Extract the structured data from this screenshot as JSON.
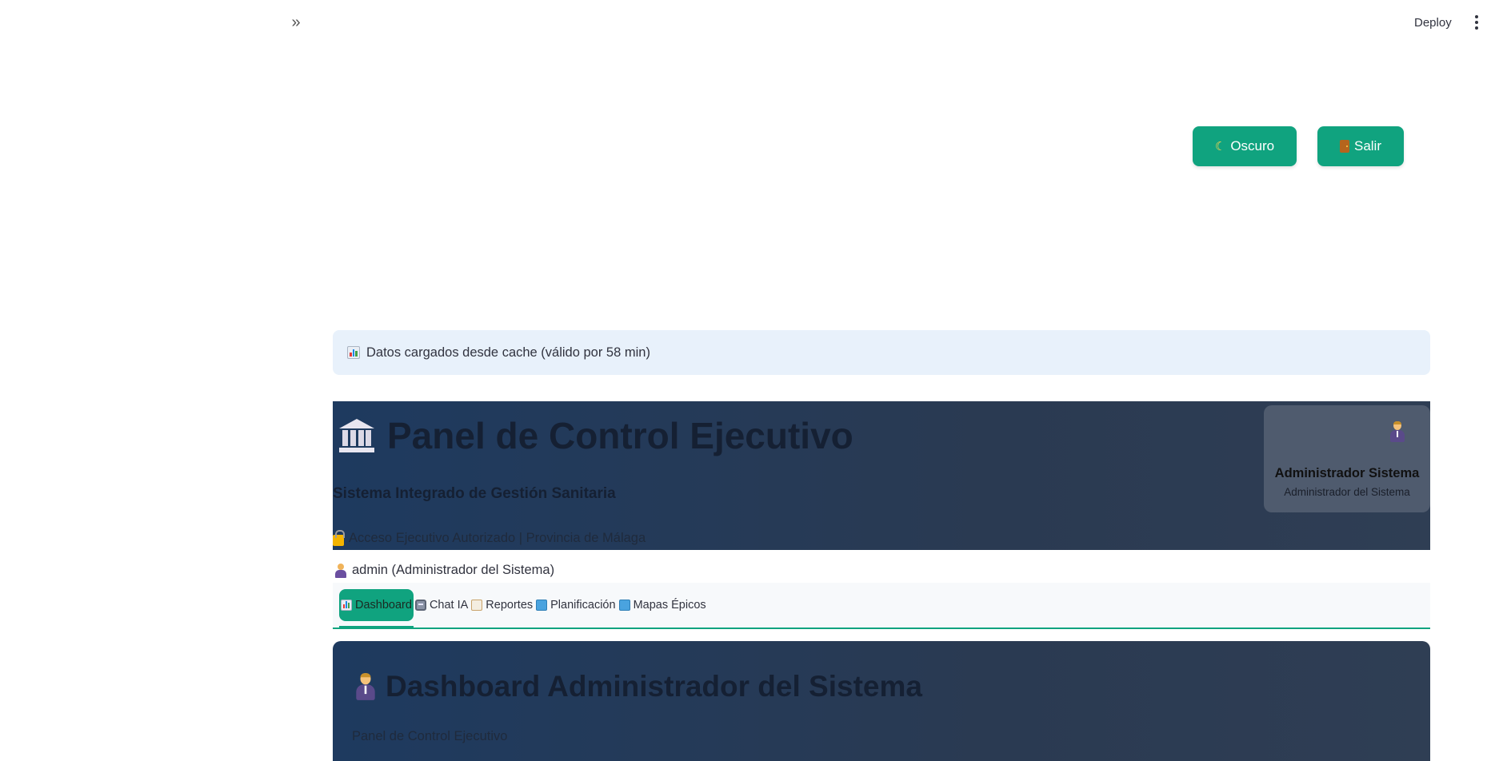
{
  "toolbar": {
    "expand_glyph": "»",
    "deploy_label": "Deploy"
  },
  "actions": {
    "dark_label": "Oscuro",
    "logout_label": "Salir"
  },
  "cache_notice": {
    "text": "Datos cargados desde cache (válido por 58 min)"
  },
  "header": {
    "title": "Panel de Control Ejecutivo",
    "subtitle": "Sistema Integrado de Gestión Sanitaria",
    "access": "Acceso Ejecutivo Autorizado | Provincia de Málaga",
    "user_card": {
      "name": "Administrador Sistema",
      "role": "Administrador del Sistema"
    }
  },
  "session": {
    "user_text": "admin (Administrador del Sistema)"
  },
  "tabs": [
    {
      "label": "Dashboard",
      "icon": "chart-icon",
      "active": true
    },
    {
      "label": "Chat IA",
      "icon": "robot-icon",
      "active": false
    },
    {
      "label": "Reportes",
      "icon": "clipboard-icon",
      "active": false
    },
    {
      "label": "Planificación",
      "icon": "map-icon",
      "active": false
    },
    {
      "label": "Mapas Épicos",
      "icon": "map-icon",
      "active": false
    }
  ],
  "dashboard": {
    "title": "Dashboard Administrador del Sistema",
    "subtitle": "Panel de Control Ejecutivo"
  },
  "colors": {
    "accent": "#10a37f",
    "hero_bg": "#1e3a5f",
    "info_bg": "#e8f1fb"
  }
}
